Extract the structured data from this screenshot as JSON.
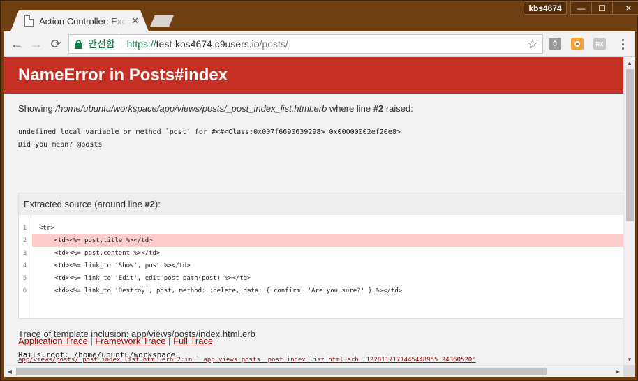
{
  "window": {
    "tab_title": "Action Controller: Exception caught",
    "tab_close": "✕",
    "profile": "kbs4674",
    "minimize": "—",
    "maximize": "☐",
    "close": "✕"
  },
  "toolbar": {
    "back": "←",
    "forward": "→",
    "reload": "⟳",
    "secure_label": "안전함",
    "url_scheme": "https://",
    "url_host": "test-kbs4674.c9users.io",
    "url_path": "/posts/",
    "star": "☆",
    "ext1": "0",
    "ext2": "",
    "ext3": "RX"
  },
  "page": {
    "heading": "NameError in Posts#index",
    "showing_prefix": "Showing ",
    "showing_path": "/home/ubuntu/workspace/app/views/posts/_post_index_list.html.erb",
    "showing_middle": " where line ",
    "showing_line": "#2",
    "showing_suffix": " raised:",
    "message_line1": "undefined local variable or method `post' for #<#<Class:0x007f6690639298>:0x00000002ef20e8>",
    "message_line2": "Did you mean?  @posts",
    "source_head_prefix": "Extracted source (around line ",
    "source_head_line": "#2",
    "source_head_suffix": "):",
    "source_lines": [
      {
        "num": "1",
        "code": "<tr>"
      },
      {
        "num": "2",
        "code": "    <td><%= post.title %></td>"
      },
      {
        "num": "3",
        "code": "    <td><%= post.content %></td>"
      },
      {
        "num": "4",
        "code": "    <td><%= link_to 'Show', post %></td>"
      },
      {
        "num": "5",
        "code": "    <td><%= link_to 'Edit', edit_post_path(post) %></td>"
      },
      {
        "num": "6",
        "code": "    <td><%= link_to 'Destroy', post, method: :delete, data: { confirm: 'Are you sure?' } %></td>"
      }
    ],
    "highlight_line": 2,
    "trace_inclusion": "Trace of template inclusion: app/views/posts/index.html.erb",
    "rails_root": "Rails.root: /home/ubuntu/workspace",
    "link_application": "Application Trace",
    "link_framework": "Framework Trace",
    "link_full": "Full Trace",
    "link_sep": " | ",
    "trace_line": "app/views/posts/_post_index_list.html.erb:2:in `_app_views_posts__post_index_list_html_erb__1228117171445448955_24360520'"
  },
  "colors": {
    "header_red": "#c52f24",
    "link_red": "#980905",
    "highlight": "#ffcccc",
    "frame_brown": "#6e3f10",
    "secure_green": "#0b8043"
  }
}
